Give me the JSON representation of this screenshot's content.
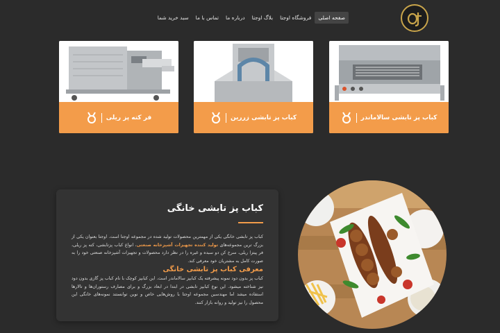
{
  "nav": {
    "logo_icon": "brand-logo-icon",
    "items": [
      {
        "label": "صفحه اصلی",
        "active": true
      },
      {
        "label": "فروشگاه اوجتا"
      },
      {
        "label": "بلاگ اوجتا"
      },
      {
        "label": "درباره ما"
      },
      {
        "label": "تماس با ما"
      },
      {
        "label": "سبد خرید شما"
      }
    ]
  },
  "products": [
    {
      "label": "کباب پز تابشی سالاماندر",
      "icon": "medal-icon"
    },
    {
      "label": "کباب پز تابشی زررین",
      "icon": "medal-icon"
    },
    {
      "label": "فر کته پز ریلی",
      "icon": "medal-icon"
    }
  ],
  "about": {
    "title": "کباب پز تابشی خانگی",
    "p1_a": "کباب پز تابشی خانگی یکی از مهمترین محصولات تولید شده در مجموعه اوجتا است. اوجتا بعنوان یکی از بزرگ ترین مجموعه‌های ",
    "p1_highlight": "تولید کننده تجهیزات آشپزخانه صنعتی",
    "p1_b": "، انواع کباب پزتابشی، کته پز ریلی، فر پیتزا ریلی، سرخ کن دو سبده و غیره را در نظر دارد محصولات و تجهیزات آشپزخانه صنعتی خود را به صورت کامل به مشتریان خود معرفی کند.",
    "subtitle": "معرفی کباب پز تابشی خانگی",
    "p2": "کباب پز بدون دود نمونه پیشرفته یک کبابپز سالاماندر است. این کبابپز کوچک با نام کباب پز گازی بدون دود نیز شناخته میشود. این نوع کبابپز تابشی در ابتدا در ابعاد بزرگ و برای مصارف رستوران‌ها و تالارها استفاده میشد اما مهندسین مجموعه اوجتا با روش‌هایی خاص و نوین توانستند نمونه‌های خانگی این محصول را نیز تولید و روانه بازار کنند."
  },
  "colors": {
    "accent": "#f39c4a",
    "background": "#2b2b2b",
    "panel": "#333333",
    "logo_ring": "#c9a54b"
  }
}
